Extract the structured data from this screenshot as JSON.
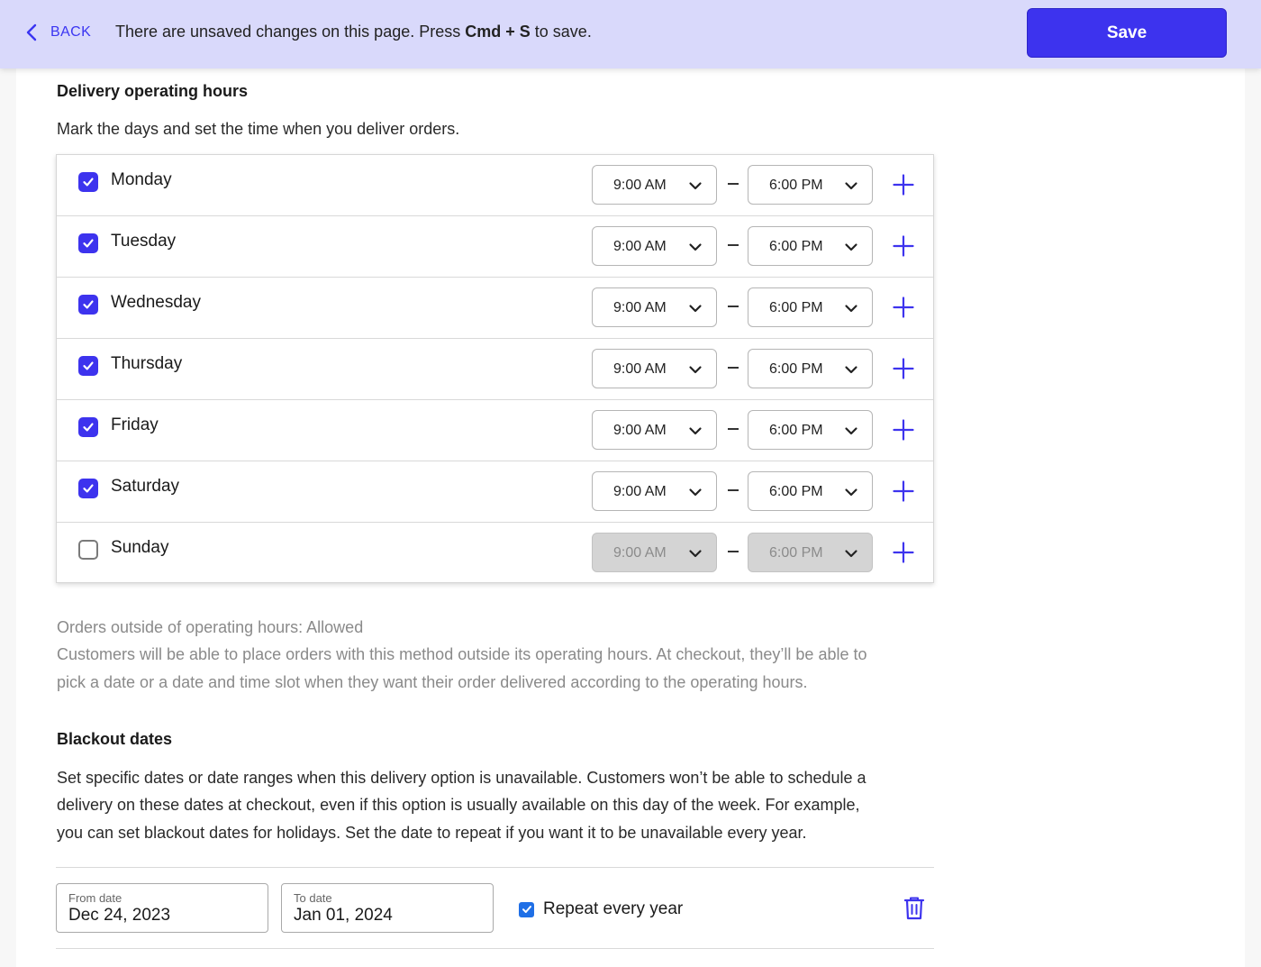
{
  "topbar": {
    "back_label": "BACK",
    "unsaved_prefix": "There are unsaved changes on this page. Press ",
    "unsaved_shortcut": "Cmd + S",
    "unsaved_suffix": " to save.",
    "save_label": "Save"
  },
  "operating_hours": {
    "title": "Delivery operating hours",
    "description": "Mark the days and set the time when you deliver orders.",
    "days": [
      {
        "label": "Monday",
        "checked": true,
        "from": "9:00 AM",
        "to": "6:00 PM"
      },
      {
        "label": "Tuesday",
        "checked": true,
        "from": "9:00 AM",
        "to": "6:00 PM"
      },
      {
        "label": "Wednesday",
        "checked": true,
        "from": "9:00 AM",
        "to": "6:00 PM"
      },
      {
        "label": "Thursday",
        "checked": true,
        "from": "9:00 AM",
        "to": "6:00 PM"
      },
      {
        "label": "Friday",
        "checked": true,
        "from": "9:00 AM",
        "to": "6:00 PM"
      },
      {
        "label": "Saturday",
        "checked": true,
        "from": "9:00 AM",
        "to": "6:00 PM"
      },
      {
        "label": "Sunday",
        "checked": false,
        "from": "9:00 AM",
        "to": "6:00 PM"
      }
    ]
  },
  "outside_hours": {
    "title": "Orders outside of operating hours: Allowed",
    "line1": "Customers will be able to place orders with this method outside its operating hours. At checkout, they’ll be able to",
    "line2": "pick a date or a date and time slot when they want their order delivered according to the operating hours."
  },
  "blackout": {
    "title": "Blackout dates",
    "line1": "Set specific dates or date ranges when this delivery option is unavailable. Customers won’t be able to schedule a",
    "line2": "delivery on these dates at checkout, even if this option is usually available on this day of the week. For example,",
    "line3": "you can set blackout dates for holidays. Set the date to repeat if you want it to be unavailable every year.",
    "from_label": "From date",
    "from_value": "Dec 24, 2023",
    "to_label": "To date",
    "to_value": "Jan 01, 2024",
    "repeat_label": "Repeat every year",
    "repeat_checked": true
  },
  "colors": {
    "accent": "#3d33ee",
    "topbar_bg": "#d9d9fb",
    "disabled_select": "#d4d4d4"
  },
  "icons": [
    "chevron-left-icon",
    "checkmark-icon",
    "chevron-down-icon",
    "plus-icon",
    "trash-icon"
  ]
}
